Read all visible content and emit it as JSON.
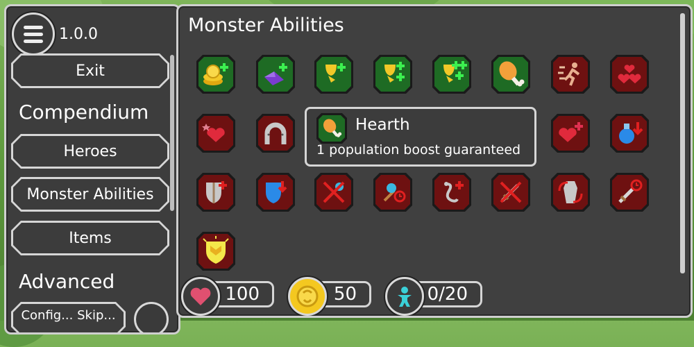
{
  "app": {
    "version": "1.0.0"
  },
  "sidebar": {
    "exit_label": "Exit",
    "compendium_heading": "Compendium",
    "compendium_items": [
      {
        "label": "Heroes"
      },
      {
        "label": "Monster Abilities"
      },
      {
        "label": "Items"
      }
    ],
    "advanced_heading": "Advanced",
    "partial_button_label": "Config... Skip..."
  },
  "main": {
    "title": "Monster Abilities",
    "abilities": [
      {
        "icon": "gold-plus-icon",
        "type": "green"
      },
      {
        "icon": "purple-gem-plus-icon",
        "type": "green"
      },
      {
        "icon": "trophy-plus-icon",
        "type": "green"
      },
      {
        "icon": "trophy-double-plus-icon",
        "type": "green"
      },
      {
        "icon": "trophy-triple-plus-icon",
        "type": "green"
      },
      {
        "icon": "drumstick-icon",
        "type": "green"
      },
      {
        "icon": "running-man-icon",
        "type": "red"
      },
      {
        "icon": "triple-hearts-icon",
        "type": "red"
      },
      {
        "icon": "sparkle-heart-icon",
        "type": "red"
      },
      {
        "icon": "horseshoe-icon",
        "type": "red"
      },
      {
        "icon": "heart-plus-icon",
        "type": "red"
      },
      {
        "icon": "mana-potion-down-icon",
        "type": "red"
      },
      {
        "icon": "shield-plus-icon",
        "type": "red"
      },
      {
        "icon": "blue-shield-down-icon",
        "type": "red"
      },
      {
        "icon": "crossed-wand-icon",
        "type": "red"
      },
      {
        "icon": "wand-timer-icon",
        "type": "red"
      },
      {
        "icon": "snake-plus-icon",
        "type": "red"
      },
      {
        "icon": "crossed-sword-icon",
        "type": "red"
      },
      {
        "icon": "coffin-revive-icon",
        "type": "red"
      },
      {
        "icon": "sword-timer-icon",
        "type": "red"
      },
      {
        "icon": "glowing-shield-icon",
        "type": "red"
      }
    ],
    "tooltip": {
      "icon": "drumstick-icon",
      "title": "Hearth",
      "description": "1 population boost guaranteed"
    }
  },
  "stats": {
    "health": {
      "icon": "heart-icon",
      "value": "100",
      "color": "#e05070"
    },
    "gold": {
      "icon": "gold-coin-icon",
      "value": "50",
      "color": "#f4c820"
    },
    "population": {
      "icon": "person-icon",
      "value": "0/20",
      "color": "#3ad0d8"
    }
  },
  "colors": {
    "panel_bg": "#404040",
    "border": "#d6d6d6",
    "green_tile": "#1e6b24",
    "red_tile": "#6e1111"
  }
}
